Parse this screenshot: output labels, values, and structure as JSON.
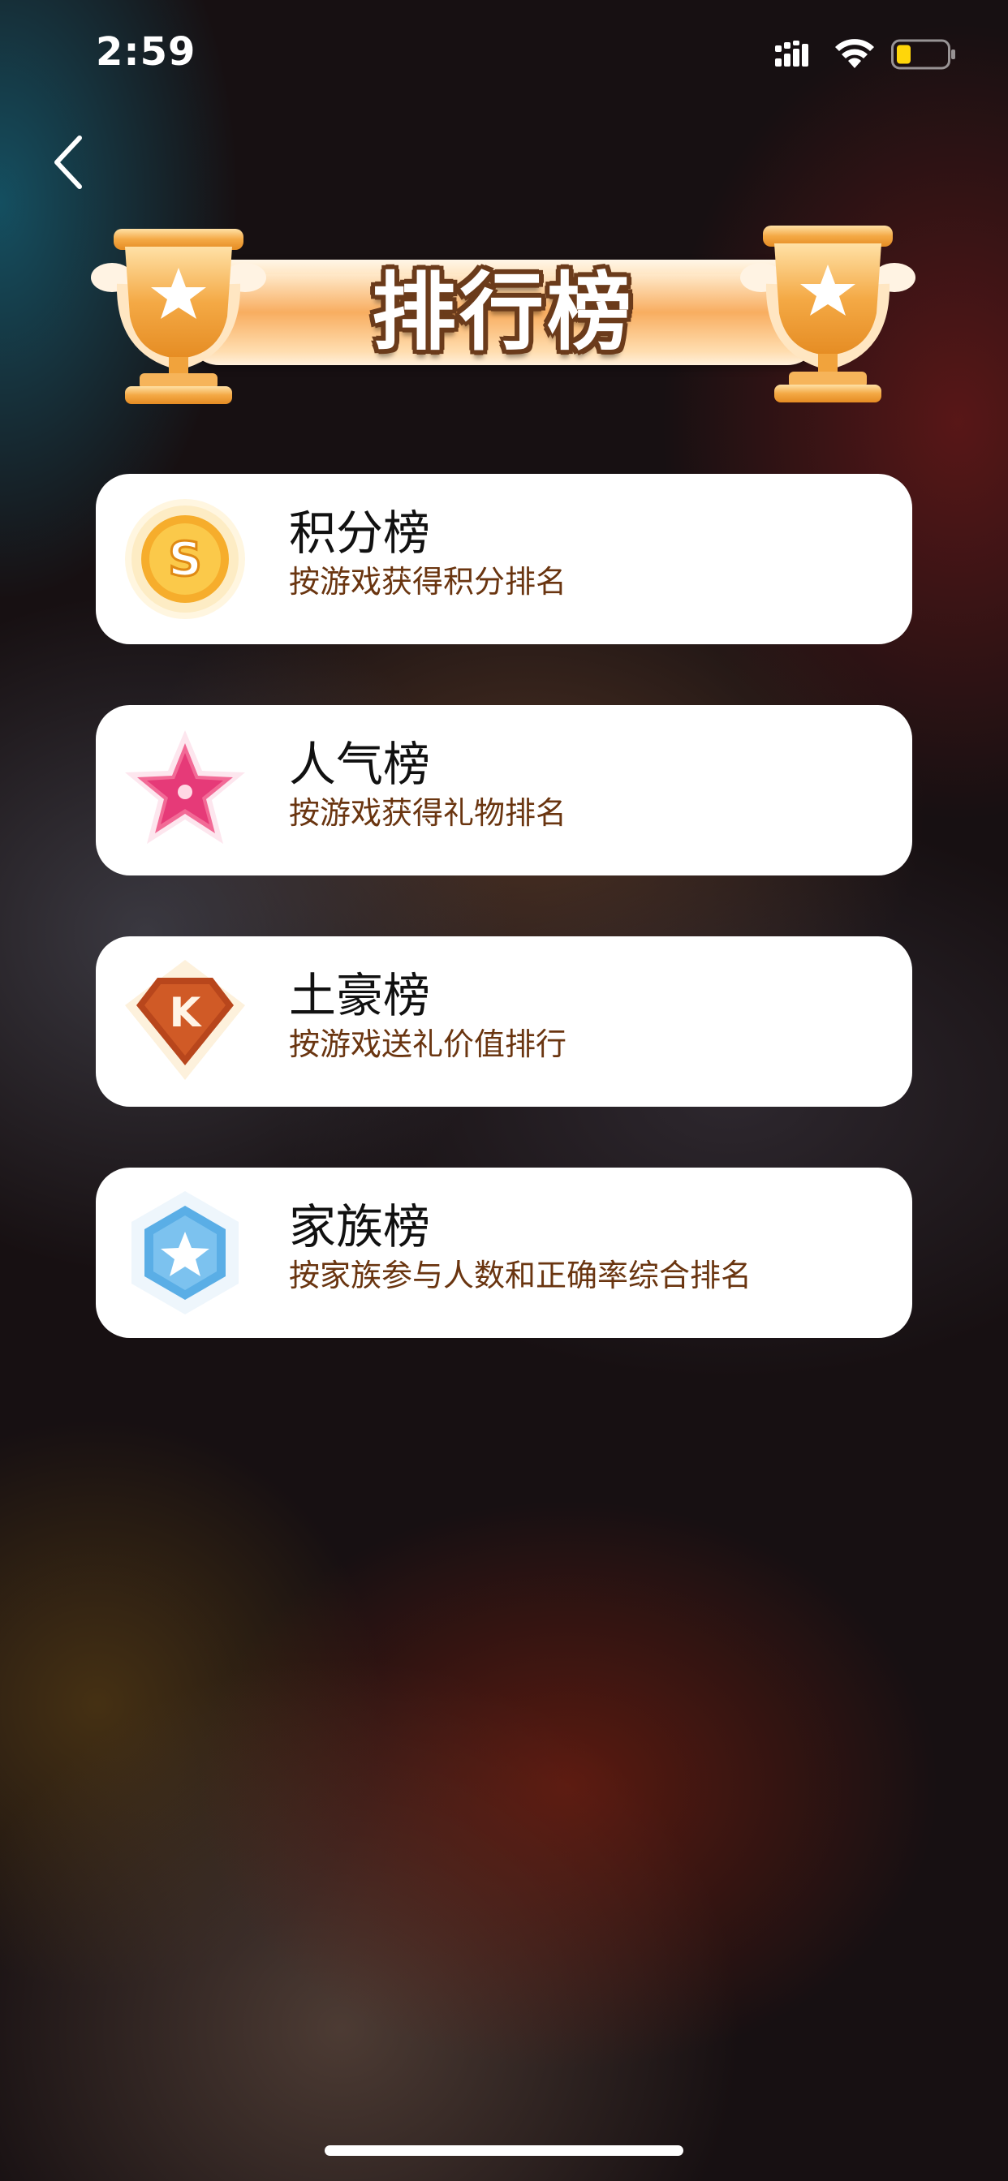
{
  "status_bar": {
    "time": "2:59",
    "icons": [
      "signal-icon",
      "wifi-icon",
      "battery-icon"
    ],
    "battery_color": "#ffd60a"
  },
  "nav": {
    "back_icon": "chevron-left-icon"
  },
  "banner": {
    "title": "排行榜",
    "icons": [
      "trophy-icon",
      "trophy-icon"
    ]
  },
  "leaderboards": [
    {
      "icon": "coin-s-icon",
      "title": "积分榜",
      "subtitle": "按游戏获得积分排名"
    },
    {
      "icon": "pink-star-icon",
      "title": "人气榜",
      "subtitle": "按游戏获得礼物排名"
    },
    {
      "icon": "k-shield-icon",
      "title": "土豪榜",
      "subtitle": "按游戏送礼价值排行"
    },
    {
      "icon": "blue-hexagon-star-icon",
      "title": "家族榜",
      "subtitle": "按家族参与人数和正确率综合排名"
    }
  ],
  "colors": {
    "title_outline": "#6b3b1b",
    "subtitle_text": "#6a3510",
    "card_background": "#ffffff"
  }
}
